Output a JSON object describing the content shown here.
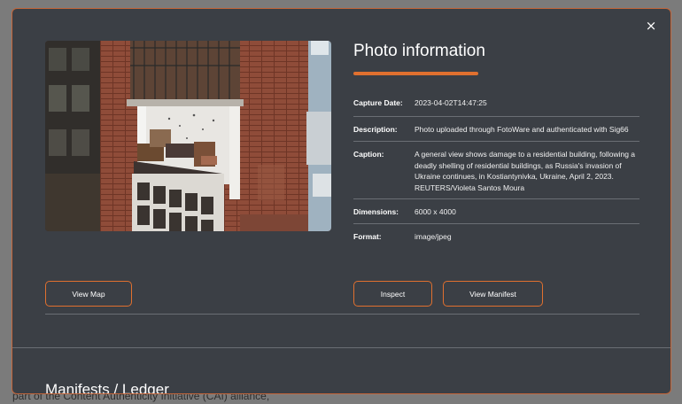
{
  "background": {
    "text": "part of the Content Authenticity Initiative (CAI) alliance,"
  },
  "modal": {
    "close_label": "×",
    "title": "Photo information",
    "accent_color": "#e0702f",
    "details": [
      {
        "label": "Capture Date:",
        "value": "2023-04-02T14:47:25"
      },
      {
        "label": "Description:",
        "value": "Photo uploaded through FotoWare and authenticated with Sig66"
      },
      {
        "label": "Caption:",
        "value": "A general view shows damage to a residential building, following a deadly shelling of residential buildings, as Russia's invasion of Ukraine continues, in Kostiantynivka, Ukraine, April 2, 2023. REUTERS/Violeta Santos Moura"
      },
      {
        "label": "Dimensions:",
        "value": "6000 x 4000"
      },
      {
        "label": "Format:",
        "value": "image/jpeg"
      }
    ],
    "buttons": {
      "view_map": "View Map",
      "inspect": "Inspect",
      "view_manifest": "View Manifest"
    },
    "section_title": "Manifests / Ledger"
  }
}
